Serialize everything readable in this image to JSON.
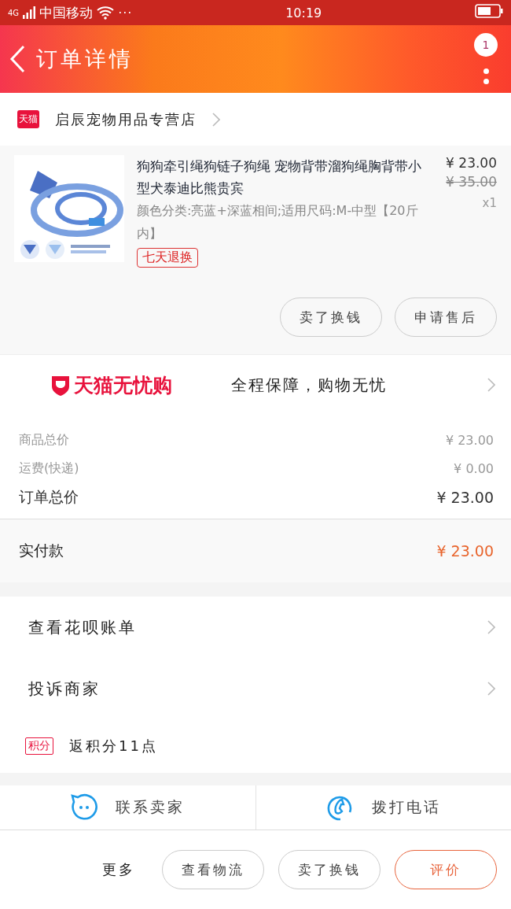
{
  "status_bar": {
    "network": "4G",
    "carrier": "中国移动",
    "more": "···",
    "time": "10:19"
  },
  "header": {
    "title": "订单详情",
    "badge": "1"
  },
  "store": {
    "badge": "天猫",
    "name": "启辰宠物用品专营店"
  },
  "product": {
    "image": {
      "kind": "picture"
    },
    "title": "狗狗牵引绳狗链子狗绳 宠物背带溜狗绳胸背带小型犬泰迪比熊贵宾",
    "sku": "颜色分类:亮蓝+深蓝相间;适用尺码:M-中型【20斤内】",
    "tag": "七天退换",
    "price": "¥ 23.00",
    "original_price": "¥ 35.00",
    "quantity": "x1",
    "actions": [
      "卖了换钱",
      "申请售后"
    ]
  },
  "guarantee": {
    "brand": "天猫无忧购",
    "slogan": "全程保障，购物无忧"
  },
  "costs": [
    {
      "label": "商品总价",
      "value": "¥ 23.00",
      "kind": "minor"
    },
    {
      "label": "运费(快递)",
      "value": "¥ 0.00",
      "kind": "minor"
    },
    {
      "label": "订单总价",
      "value": "¥ 23.00",
      "kind": "major"
    }
  ],
  "paid": {
    "label": "实付款",
    "value": "¥ 23.00"
  },
  "menu": [
    {
      "label": "查看花呗账单",
      "kind": "link"
    },
    {
      "label": "投诉商家",
      "kind": "link"
    },
    {
      "label": "返积分11点",
      "badge": "积分",
      "kind": "points"
    }
  ],
  "contact": [
    {
      "label": "联系卖家",
      "kind": "chat"
    },
    {
      "label": "拨打电话",
      "kind": "phone"
    }
  ],
  "bottom_bar": {
    "more": "更多",
    "buttons": [
      {
        "label": "查看物流",
        "kind": "plain"
      },
      {
        "label": "卖了换钱",
        "kind": "plain"
      },
      {
        "label": "评价",
        "kind": "accent"
      }
    ]
  }
}
